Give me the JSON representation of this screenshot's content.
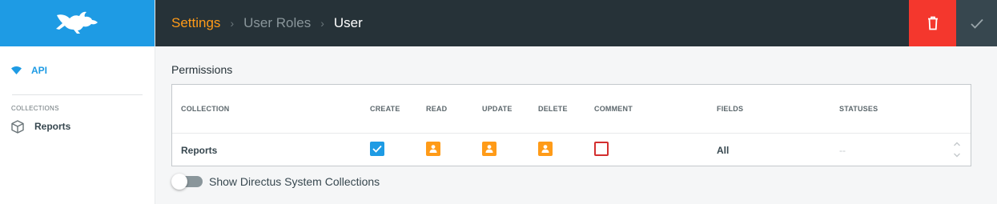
{
  "brand": {
    "color": "#1e9be4",
    "logo_icon": "rabbit-logo-icon"
  },
  "sidebar": {
    "api_label": "API",
    "collections_heading": "COLLECTIONS",
    "items": [
      {
        "label": "Reports",
        "icon": "box-icon"
      }
    ]
  },
  "header": {
    "breadcrumb": [
      {
        "label": "Settings"
      },
      {
        "label": "User Roles"
      },
      {
        "label": "User"
      }
    ],
    "separator": "›",
    "delete_icon": "trash-icon",
    "save_icon": "check-icon"
  },
  "permissions": {
    "title": "Permissions",
    "columns": [
      "COLLECTION",
      "CREATE",
      "READ",
      "UPDATE",
      "DELETE",
      "COMMENT",
      "FIELDS",
      "STATUSES"
    ],
    "rows": [
      {
        "collection": "Reports",
        "create": "checked",
        "read": "mine",
        "update": "mine",
        "delete": "mine",
        "comment": "none",
        "fields": "All",
        "statuses": "--"
      }
    ]
  },
  "toggle": {
    "label": "Show Directus System Collections",
    "on": false
  },
  "colors": {
    "accent": "#ff9b18",
    "danger": "#f4372d",
    "header_bg": "#263238"
  }
}
